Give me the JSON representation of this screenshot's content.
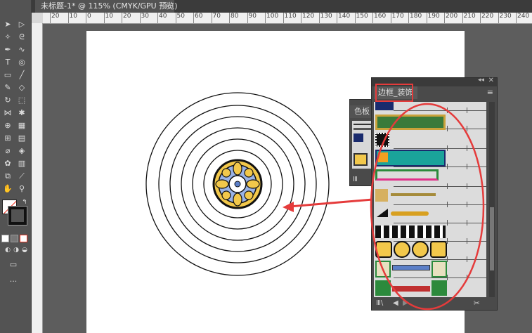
{
  "document_tab": {
    "title": "未标题-1* @ 115% (CMYK/GPU 预览)",
    "close_label": "×"
  },
  "ruler": {
    "ticks": [
      "20",
      "10",
      "0",
      "10",
      "20",
      "30",
      "40",
      "50",
      "60",
      "70",
      "80",
      "90",
      "100",
      "110",
      "120",
      "130",
      "140",
      "150",
      "160",
      "170",
      "180",
      "190",
      "200",
      "210",
      "220",
      "230",
      "240"
    ]
  },
  "panels": {
    "border_library": {
      "title": "边框_装饰",
      "collapse_icon": "double-arrow-icon",
      "close_icon": "close-icon",
      "menu_icon": "menu-icon",
      "footer_icons": [
        "library-menu-icon",
        "prev-icon",
        "next-icon",
        "settings-icon"
      ]
    },
    "swatches": {
      "title": "色板",
      "footer_icon": "library-menu-icon"
    }
  },
  "annotation": {
    "highlight_color": "#e53b3b",
    "arrow_color": "#e53b3b"
  },
  "colors": {
    "ui_background": "#535353",
    "artboard": "#ffffff",
    "pattern_gold": "#f2c84b",
    "pattern_blue": "#5b7fc8",
    "pattern_teal": "#1aa39a",
    "pattern_navy": "#1a2b6d"
  }
}
